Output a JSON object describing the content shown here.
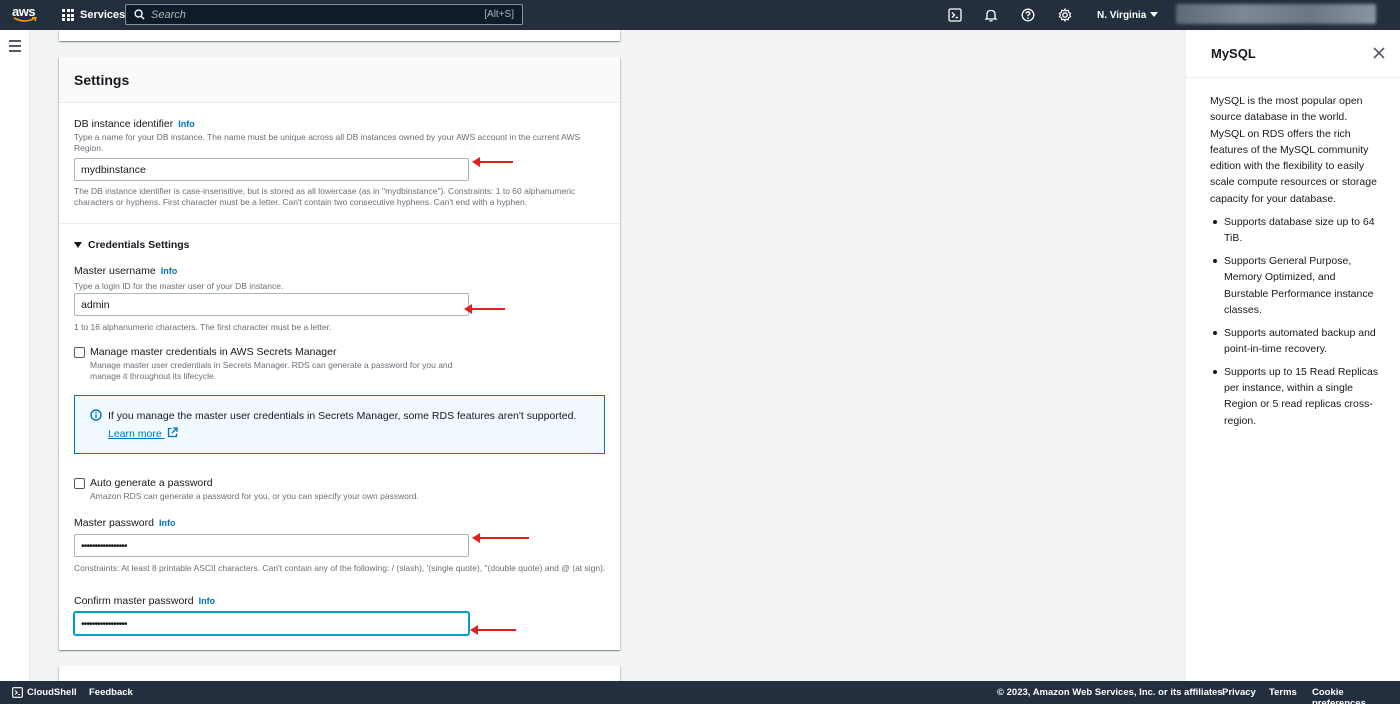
{
  "topnav": {
    "logo_text": "aws",
    "services_label": "Services",
    "search_placeholder": "Search",
    "search_shortcut": "[Alt+S]",
    "region": "N. Virginia"
  },
  "settings": {
    "title": "Settings",
    "db_identifier": {
      "label": "DB instance identifier",
      "info": "Info",
      "desc": "Type a name for your DB instance. The name must be unique across all DB instances owned by your AWS account in the current AWS Region.",
      "value": "mydbinstance",
      "constraint": "The DB instance identifier is case-insensitive, but is stored as all lowercase (as in \"mydbinstance\"). Constraints: 1 to 60 alphanumeric characters or hyphens. First character must be a letter. Can't contain two consecutive hyphens. Can't end with a hyphen."
    },
    "credentials": {
      "title": "Credentials Settings",
      "username_label": "Master username",
      "username_info": "Info",
      "username_desc": "Type a login ID for the master user of your DB instance.",
      "username_value": "admin",
      "username_constraint": "1 to 16 alphanumeric characters. The first character must be a letter.",
      "secrets_label": "Manage master credentials in AWS Secrets Manager",
      "secrets_desc": "Manage master user credentials in Secrets Manager. RDS can generate a password for you and manage it throughout its lifecycle.",
      "infobox_text": "If you manage the master user credentials in Secrets Manager, some RDS features aren't supported.",
      "infobox_link": "Learn more",
      "autogen_label": "Auto generate a password",
      "autogen_desc": "Amazon RDS can generate a password for you, or you can specify your own password.",
      "password_label": "Master password",
      "password_info": "Info",
      "password_value": "•••••••••••••••••",
      "password_constraint": "Constraints: At least 8 printable ASCII characters. Can't contain any of the following: / (slash), '(single quote), \"(double quote) and @ (at sign).",
      "confirm_label": "Confirm master password",
      "confirm_info": "Info",
      "confirm_value": "•••••••••••••••••"
    }
  },
  "help": {
    "title": "MySQL",
    "paragraph": "MySQL is the most popular open source database in the world. MySQL on RDS offers the rich features of the MySQL community edition with the flexibility to easily scale compute resources or storage capacity for your database.",
    "bullets": [
      "Supports database size up to 64 TiB.",
      "Supports General Purpose, Memory Optimized, and Burstable Performance instance classes.",
      "Supports automated backup and point-in-time recovery.",
      "Supports up to 15 Read Replicas per instance, within a single Region or 5 read replicas cross-region."
    ]
  },
  "footer": {
    "cloudshell": "CloudShell",
    "feedback": "Feedback",
    "copyright": "© 2023, Amazon Web Services, Inc. or its affiliates.",
    "privacy": "Privacy",
    "terms": "Terms",
    "cookies": "Cookie preferences"
  },
  "colors": {
    "nav_bg": "#232f3e",
    "link": "#0073bb",
    "arrow": "#e02020"
  }
}
